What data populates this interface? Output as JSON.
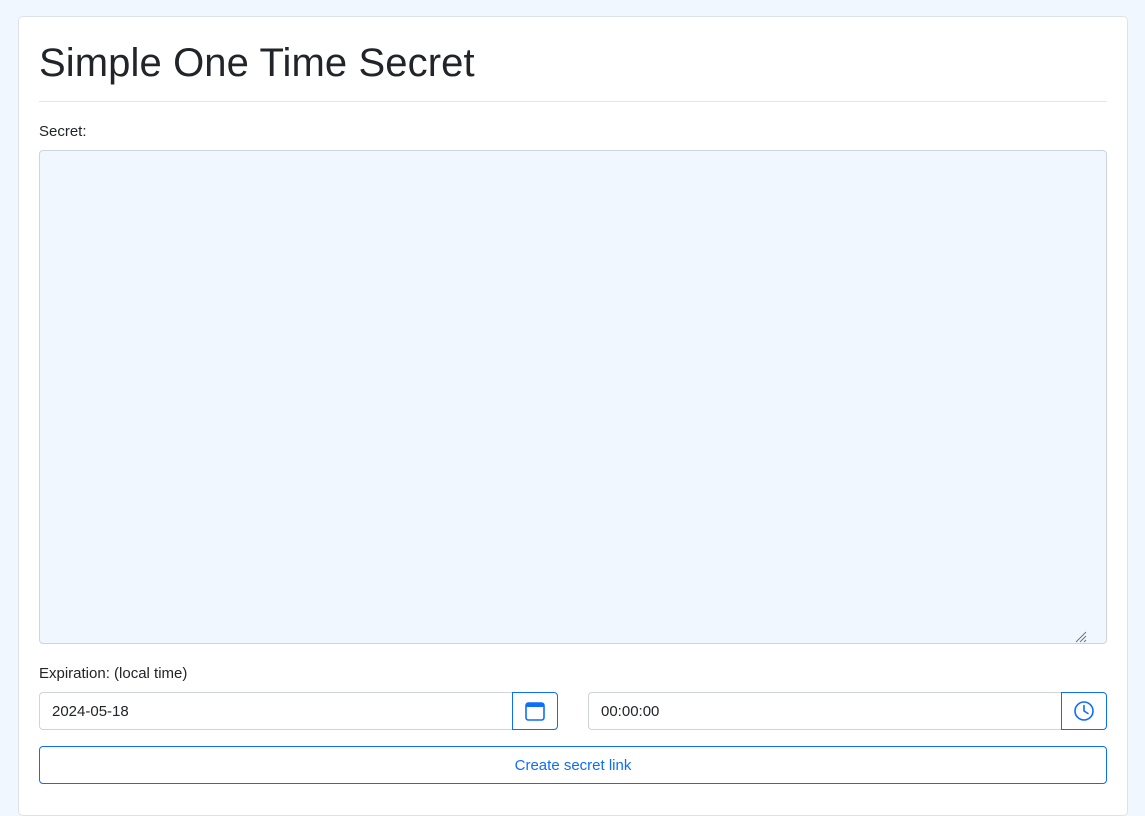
{
  "page": {
    "title": "Simple One Time Secret"
  },
  "secret": {
    "label": "Secret:",
    "value": "",
    "background_color": "#f0f7fe"
  },
  "expiration": {
    "label": "Expiration: (local time)",
    "date_value": "2024-05-18",
    "date_icon": "calendar-icon",
    "time_value": "00:00:00",
    "time_icon": "clock-icon"
  },
  "actions": {
    "create_label": "Create secret link"
  },
  "colors": {
    "accent": "#0d6efd",
    "page_background": "#f0f7fe",
    "text": "#212529"
  }
}
